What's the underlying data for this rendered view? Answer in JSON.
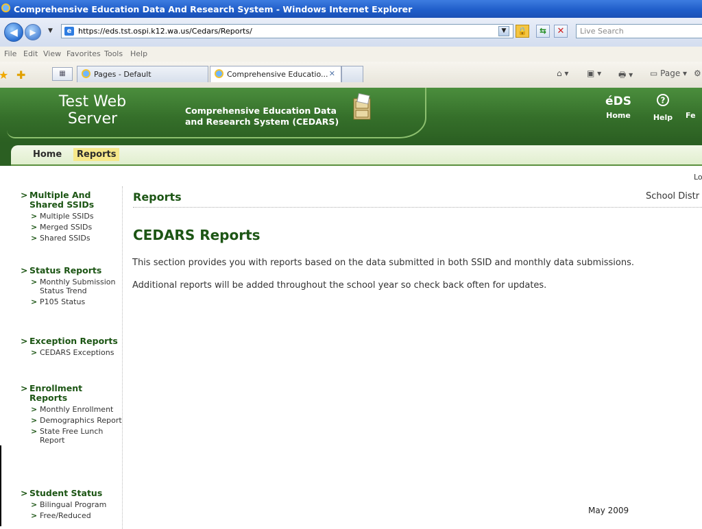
{
  "window": {
    "title": "Comprehensive Education Data And Research System - Windows Internet Explorer"
  },
  "addressbar": {
    "url": "https://eds.tst.ospi.k12.wa.us/Cedars/Reports/",
    "search_placeholder": "Live Search"
  },
  "menubar": [
    "File",
    "Edit",
    "View",
    "Favorites",
    "Tools",
    "Help"
  ],
  "tabs": [
    {
      "label": "Pages - Default"
    },
    {
      "label": "Comprehensive Educatio..."
    }
  ],
  "toolbar": {
    "page_label": "Page"
  },
  "header": {
    "site_name": "Test Web Server",
    "app_name_line1": "Comprehensive Education Data",
    "app_name_line2": "and Research System (CEDARS)",
    "links": [
      {
        "icon": "eds-logo-icon",
        "glyph": "éDS",
        "label": "Home"
      },
      {
        "icon": "help-icon",
        "glyph": "?",
        "label": "Help"
      },
      {
        "icon": "feedback-icon",
        "glyph": "",
        "label": "Fe"
      }
    ]
  },
  "nav": {
    "items": [
      {
        "label": "Home",
        "selected": false
      },
      {
        "label": "Reports",
        "selected": true
      }
    ]
  },
  "sidebar": {
    "groups": [
      {
        "title": "Multiple And Shared SSIDs",
        "items": [
          "Multiple SSIDs",
          "Merged SSIDs",
          "Shared SSIDs"
        ]
      },
      {
        "title": "Status Reports",
        "items": [
          "Monthly Submission Status Trend",
          "P105 Status"
        ]
      },
      {
        "title": "Exception Reports",
        "items": [
          "CEDARS Exceptions"
        ]
      },
      {
        "title": "Enrollment Reports",
        "items": [
          "Monthly Enrollment",
          "Demographics Report",
          "State Free Lunch Report"
        ]
      },
      {
        "title": "Student Status",
        "items": [
          "Bilingual Program",
          "Free/Reduced"
        ]
      }
    ]
  },
  "main": {
    "login_fragment": "Lo",
    "page_heading": "Reports",
    "district_fragment": "School Distr",
    "section_title": "CEDARS Reports",
    "paragraphs": [
      "This section provides you with reports based on the data submitted in both SSID and monthly data submissions.",
      "Additional reports will be added throughout the school year so check back often for updates."
    ],
    "footer_date": "May 2009"
  },
  "colors": {
    "header_green": "#356f2a",
    "heading_green": "#1c5514",
    "nav_selected": "#f6e88a"
  }
}
